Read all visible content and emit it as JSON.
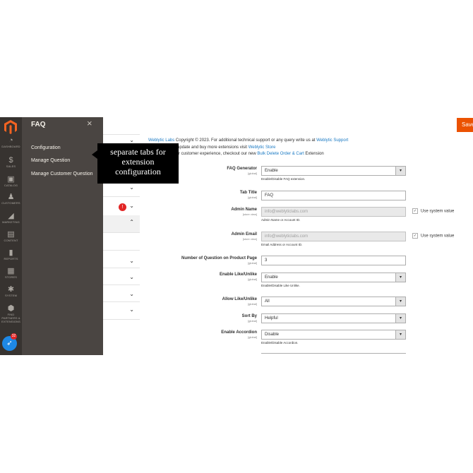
{
  "nav": {
    "items": [
      {
        "label": "DASHBOARD",
        "icon": "dashboard-icon",
        "glyph": "◔"
      },
      {
        "label": "SALES",
        "icon": "dollar-icon",
        "glyph": "$"
      },
      {
        "label": "CATALOG",
        "icon": "cube-icon",
        "glyph": "▣"
      },
      {
        "label": "CUSTOMERS",
        "icon": "person-icon",
        "glyph": "♟"
      },
      {
        "label": "MARKETING",
        "icon": "megaphone-icon",
        "glyph": "◢"
      },
      {
        "label": "CONTENT",
        "icon": "content-icon",
        "glyph": "▤"
      },
      {
        "label": "REPORTS",
        "icon": "bar-chart-icon",
        "glyph": "▮"
      },
      {
        "label": "STORES",
        "icon": "store-icon",
        "glyph": "▦"
      },
      {
        "label": "SYSTEM",
        "icon": "gear-icon",
        "glyph": "✱"
      },
      {
        "label": "FIND PARTNERS & EXTENSIONS",
        "icon": "extensions-icon",
        "glyph": "⬢"
      }
    ],
    "help_badge": "32"
  },
  "flyout": {
    "title": "FAQ",
    "close": "×",
    "links": [
      "Configuration",
      "Manage Question",
      "Manage Customer Question"
    ]
  },
  "tooltip": {
    "line1": "separate tabs for",
    "line2": "extension",
    "line3": "configuration"
  },
  "tabs": {
    "badge": "!"
  },
  "header": {
    "save_label": "Save"
  },
  "info": {
    "line1_link": "Weblytic Labs",
    "line1_text": " Copyright © 2023. For additional technical support or any query write us at ",
    "line1_link2": "Weblytic Support",
    "line2_text": "update and buy more extensions visit ",
    "line2_link": "Weblytic Store",
    "line3_text": "r customer experience, checkout our new ",
    "line3_link": "Bulk Delete Order & Cart",
    "line3_tail": " Extension"
  },
  "form": {
    "faq_generator": {
      "label": "FAQ Generator",
      "scope": "[global]",
      "value": "Enable",
      "note": "Enable/Disable FAQ extension."
    },
    "tab_title": {
      "label": "Tab Title",
      "scope": "[global]",
      "value": "FAQ"
    },
    "admin_name": {
      "label": "Admin Name",
      "scope": "[store view]",
      "placeholder": "info@weblyticlabs.com",
      "note": "Admin Name or Account ID.",
      "use_system": "Use system value",
      "check": "✓"
    },
    "admin_email": {
      "label": "Admin Email",
      "scope": "[store view]",
      "placeholder": "info@weblyticlabs.com",
      "note": "Email Address or Account ID.",
      "use_system": "Use system value",
      "check": "✓"
    },
    "num_questions": {
      "label": "Number of Question on Product Page",
      "scope": "[global]",
      "value": "3"
    },
    "like_unlike": {
      "label": "Enable Like/Unlike",
      "scope": "[global]",
      "value": "Enable",
      "note": "Enable/Disable Like Unlike."
    },
    "allow_like": {
      "label": "Allow Like/Unlike",
      "scope": "[global]",
      "value": "All"
    },
    "sort_by": {
      "label": "Sort By",
      "scope": "[global]",
      "value": "Helpful"
    },
    "accordion": {
      "label": "Enable Accordion",
      "scope": "[global]",
      "value": "Disable",
      "note": "Enable/Disable Accordion."
    }
  },
  "colors": {
    "nav_bg": "#373330",
    "flyout_bg": "#4a4542",
    "accent": "#eb5202",
    "link": "#1979c3"
  }
}
